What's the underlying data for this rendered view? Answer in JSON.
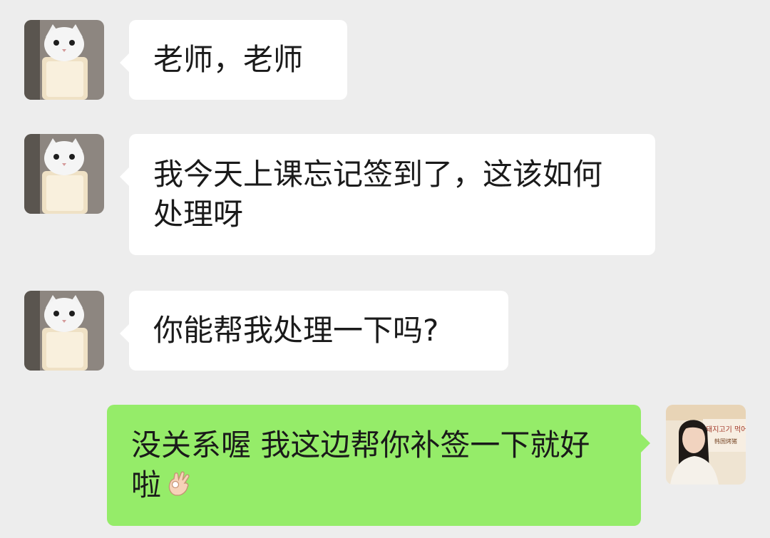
{
  "messages": [
    {
      "sender": "cat-avatar",
      "text": "老师，老师"
    },
    {
      "sender": "cat-avatar",
      "text": "我今天上课忘记签到了，这该如何处理呀"
    },
    {
      "sender": "cat-avatar",
      "text": "你能帮我处理一下吗?"
    },
    {
      "sender": "girl-avatar",
      "text": "没关系喔 我这边帮你补签一下就好啦",
      "emoji": "ok-hand-icon"
    }
  ],
  "colors": {
    "background": "#ededed",
    "incoming_bubble": "#ffffff",
    "outgoing_bubble": "#95ec69",
    "text": "#1a1a1a"
  },
  "avatar_poster_text": {
    "line1": "돼지고기 먹어",
    "line2": "韩国烤猪"
  }
}
